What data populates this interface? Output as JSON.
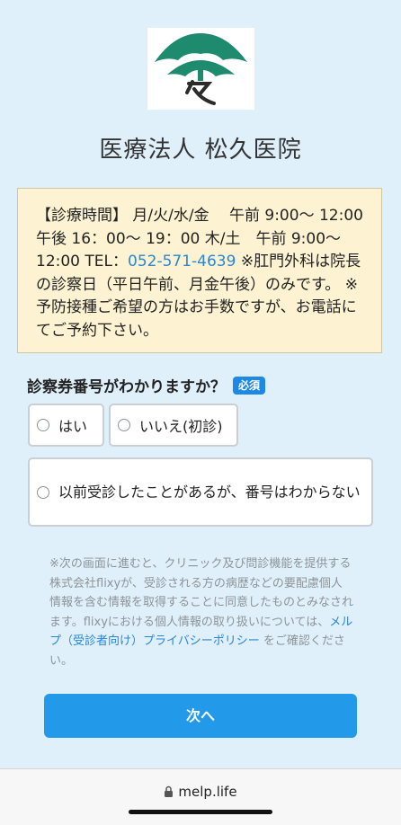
{
  "header": {
    "logo_icon": "pine-tree-kanji-logo",
    "logo_colors": {
      "tree": "#1e8a6e",
      "mark": "#2b2b2b"
    },
    "clinic_name": "医療法人 松久医院"
  },
  "notice": {
    "text_before_tel": "【診療時間】 月/火/水/金　 午前 9:00〜 12:00　午後 16：00〜 19：00 木/土　午前 9:00〜 12:00 TEL：",
    "tel": "052-571-4639",
    "text_after_tel": " ※肛門外科は院長の診察日（平日午前、月金午後）のみです。 ※予防接種ご希望の方はお手数ですが、お電話にてご予約下さい。"
  },
  "form": {
    "question": "診察券番号がわかりますか？",
    "required_badge": "必須",
    "options": [
      {
        "label": "はい"
      },
      {
        "label": "いいえ(初診)"
      },
      {
        "label": "以前受診したことがあるが、番号はわからない"
      }
    ]
  },
  "disclaimer": {
    "text_before_link": "※次の画面に進むと、クリニック及び問診機能を提供する株式会社flixyが、受診される方の病歴などの要配慮個人情報を含む情報を取得することに同意したものとみなされます。flixyにおける個人情報の取り扱いについては、",
    "link": "メルプ（受診者向け）プライバシーポリシー",
    "text_after_link": " をご確認ください。"
  },
  "next_button": "次へ",
  "browser": {
    "url": "melp.life",
    "lock_icon": "lock-icon"
  },
  "colors": {
    "background": "#dff0fb",
    "notice_bg": "#fdf3d2",
    "accent": "#2399ea",
    "link": "#2a86d6"
  }
}
